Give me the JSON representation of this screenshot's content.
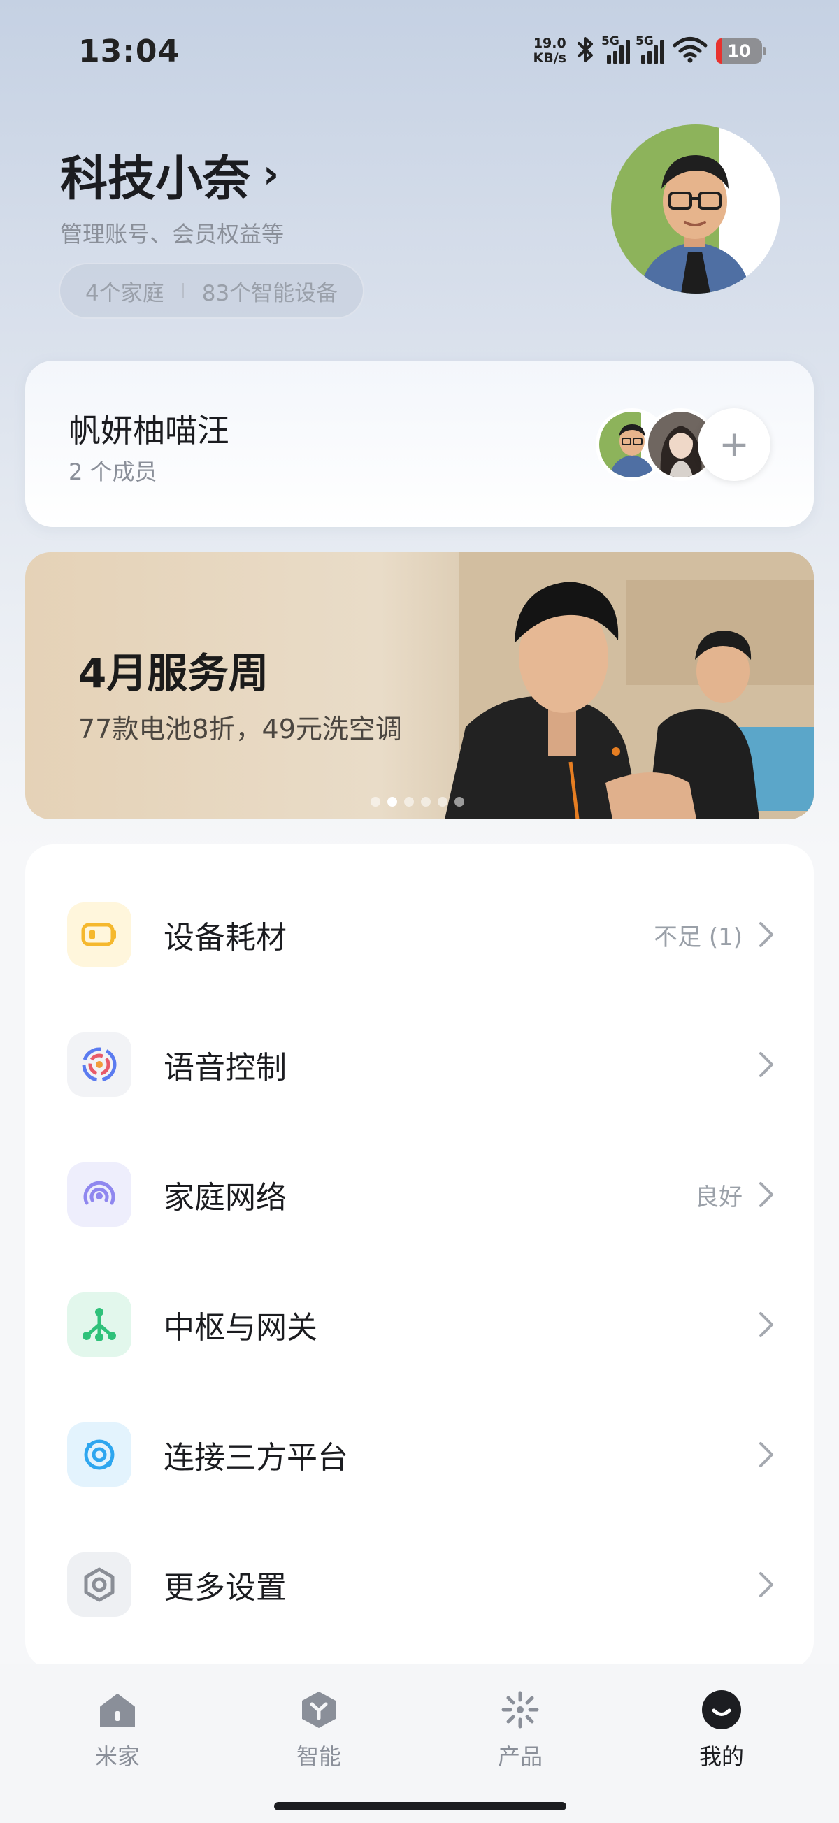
{
  "status_bar": {
    "time": "13:04",
    "net_speed_value": "19.0",
    "net_speed_unit": "KB/s",
    "signal1_tag": "5G",
    "signal2_tag": "5G",
    "battery": "10",
    "icons": [
      "bluetooth-icon",
      "signal-icon",
      "signal-icon",
      "wifi-icon",
      "battery-icon"
    ]
  },
  "profile": {
    "name": "科技小奈",
    "name_chevron": "›",
    "subtitle": "管理账号、会员权益等",
    "families": "4个家庭",
    "devices": "83个智能设备"
  },
  "family": {
    "name": "帆妍柚喵汪",
    "members": "2 个成员",
    "add_symbol": "+"
  },
  "banner": {
    "title": "4月服务周",
    "subtitle": "77款电池8折，49元洗空调",
    "slide_count": 6,
    "active_slide": 2
  },
  "menu": {
    "items": [
      {
        "label": "设备耗材",
        "status": "不足 (1)",
        "icon": "battery-icon",
        "icon_bg": "#fff6dc",
        "icon_color": "#f5b82e"
      },
      {
        "label": "语音控制",
        "status": "",
        "icon": "voice-assistant-icon",
        "icon_bg": "#f2f3f6",
        "icon_color": "#5b7bf0"
      },
      {
        "label": "家庭网络",
        "status": "良好",
        "icon": "network-icon",
        "icon_bg": "#eeeefc",
        "icon_color": "#8f87ef"
      },
      {
        "label": "中枢与网关",
        "status": "",
        "icon": "hub-gateway-icon",
        "icon_bg": "#e2f7ec",
        "icon_color": "#2fc17a"
      },
      {
        "label": "连接三方平台",
        "status": "",
        "icon": "third-party-icon",
        "icon_bg": "#e3f3fd",
        "icon_color": "#2ea6ef"
      },
      {
        "label": "更多设置",
        "status": "",
        "icon": "settings-icon",
        "icon_bg": "#eef0f3",
        "icon_color": "#8a8e96"
      }
    ]
  },
  "tabbar": {
    "tabs": [
      {
        "label": "米家",
        "icon": "home-icon",
        "active": false
      },
      {
        "label": "智能",
        "icon": "smart-icon",
        "active": false
      },
      {
        "label": "产品",
        "icon": "products-icon",
        "active": false
      },
      {
        "label": "我的",
        "icon": "profile-icon",
        "active": true
      }
    ]
  }
}
